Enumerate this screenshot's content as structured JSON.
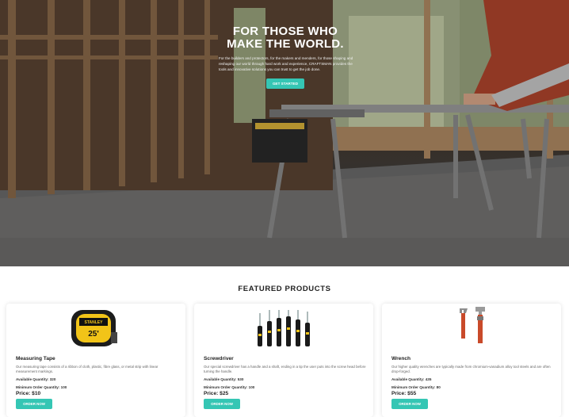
{
  "hero": {
    "title_line1": "FOR THOSE WHO",
    "title_line2": "MAKE THE WORLD.",
    "description": "For the builders and protectors, for the makers and menders, for those shaping and reshaping our world through hard work and experience, CRAFTSMAN provides the tools and innovative solutions you can trust to get the job done.",
    "cta_label": "GET STARTED"
  },
  "featured": {
    "title": "FEATURED PRODUCTS",
    "products": [
      {
        "name": "Measuring Tape",
        "description": "Our measuring tape consists of a ribbon of cloth, plastic, fibre glass, or metal strip with linear measurement markings.",
        "available": "Available Quantity: 320",
        "minimum": "Minimum Order Quantity: 100",
        "price": "Price: $10",
        "order_label": "ORDER NOW",
        "icon": "measuring-tape-icon"
      },
      {
        "name": "Screwdriver",
        "description": "Our special screwdriver has a handle and a shaft, ending in a tip the user puts into the screw head before turning the handle.",
        "available": "Available Quantity: 530",
        "minimum": "Minimum Order Quantity: 100",
        "price": "Price: $25",
        "order_label": "ORDER NOW",
        "icon": "screwdriver-set-icon"
      },
      {
        "name": "Wrench",
        "description": "Our higher quality wrenches are typically made from chromium-vanadium alloy tool steels and are often drop-forged.",
        "available": "Available Quantity: 435",
        "minimum": "Minimum Order Quantity: 80",
        "price": "Price: $55",
        "order_label": "ORDER NOW",
        "icon": "wrench-icon"
      }
    ]
  },
  "colors": {
    "accent": "#35c6b4",
    "text": "#222222"
  }
}
